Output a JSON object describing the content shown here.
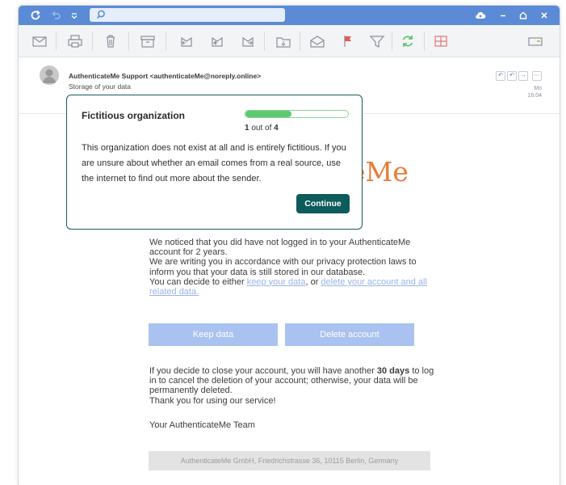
{
  "titlebar": {
    "search_placeholder": "",
    "icons": [
      "refresh-icon",
      "undo-icon",
      "quick-menu-icon",
      "search-icon",
      "cloud-icon",
      "minimize-icon",
      "maximize-icon",
      "close-icon"
    ],
    "accent": "#5b8ad6"
  },
  "toolbar": {
    "icons": [
      "mail-icon",
      "print-icon",
      "delete-icon",
      "archive-icon",
      "reply-icon",
      "reply-all-icon",
      "forward-icon",
      "move-to-folder-icon",
      "mark-read-icon",
      "flag-icon",
      "filter-icon",
      "sync-icon",
      "grid-icon",
      "more-icon"
    ]
  },
  "header": {
    "sender": "AuthenticateMe Support <authenticateMe@noreply.online>",
    "subject": "Storage of your data",
    "date_day": "Mo",
    "date_time": "16:04",
    "actions": [
      "reply-icon",
      "reply-all-icon",
      "forward-icon",
      "more-icon"
    ]
  },
  "email": {
    "logo_partial": "eMe",
    "logo_color": "#e87b35",
    "para1_a": "We noticed that you did have not logged in to your AuthenticateMe account for 2 years.",
    "para1_b": "We are writing you in accordance with our privacy protection laws to inform you that your data is still stored in our database.",
    "para1_c_start": "You can decide to either ",
    "link_keep": "keep your data",
    "para1_c_mid": ", or ",
    "link_delete": "delete your account and all related data.",
    "keep_button": "Keep data",
    "delete_button": "Delete account",
    "para2_start": "If you decide to close your account, you will have another ",
    "para2_bold": "30 days",
    "para2_end": " to log in to cancel the deletion of your account; otherwise, your data will be permanently deleted.",
    "para2_thanks": "Thank you for using our service!",
    "signature": "Your AuthenticateMe Team",
    "footer": "AuthenticateMe GmbH, Friedrichstrasse 36, 10115 Berlin, Germany"
  },
  "popup": {
    "title": "Fictitious organization",
    "progress_fraction": 0.45,
    "step_current": "1",
    "step_text": " out of ",
    "step_total": "4",
    "text": "This organization does not exist at all and is entirely fictitious. If you are unsure about whether an email comes from a real source, use the internet to find out more about the sender.",
    "continue_label": "Continue",
    "border_color": "#1b5a5a",
    "progress_color": "#5ccb6e"
  }
}
